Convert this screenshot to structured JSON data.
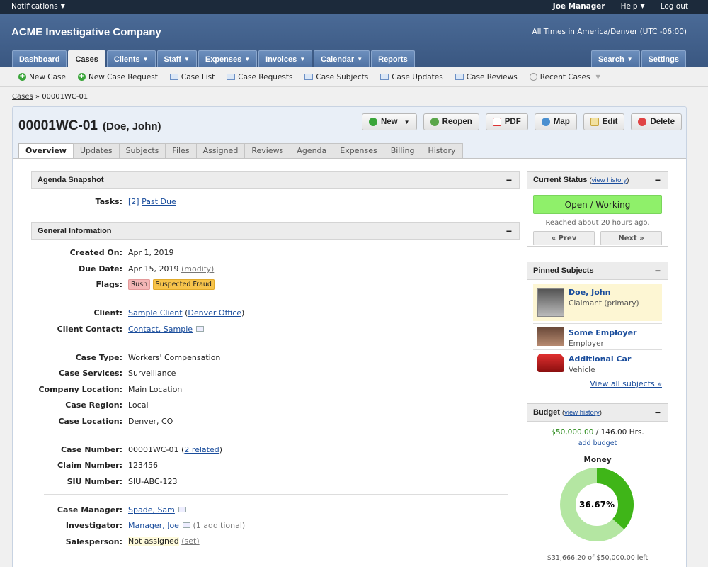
{
  "topbar": {
    "notifications": "Notifications",
    "user": "Joe Manager",
    "help": "Help",
    "logout": "Log out"
  },
  "header": {
    "company": "ACME Investigative Company",
    "timezone": "All Times in America/Denver (UTC -06:00)"
  },
  "nav": {
    "tabs": [
      {
        "label": "Dashboard"
      },
      {
        "label": "Cases"
      },
      {
        "label": "Clients"
      },
      {
        "label": "Staff"
      },
      {
        "label": "Expenses"
      },
      {
        "label": "Invoices"
      },
      {
        "label": "Calendar"
      },
      {
        "label": "Reports"
      }
    ],
    "search": "Search",
    "settings": "Settings"
  },
  "toolbar": {
    "new_case": "New Case",
    "new_case_request": "New Case Request",
    "case_list": "Case List",
    "case_requests": "Case Requests",
    "case_subjects": "Case Subjects",
    "case_updates": "Case Updates",
    "case_reviews": "Case Reviews",
    "recent_cases": "Recent Cases"
  },
  "breadcrumb": {
    "root": "Cases",
    "sep": "»",
    "current": "00001WC-01"
  },
  "case": {
    "number": "00001WC-01",
    "name": "(Doe, John)"
  },
  "actions": {
    "new": "New",
    "reopen": "Reopen",
    "pdf": "PDF",
    "map": "Map",
    "edit": "Edit",
    "delete": "Delete"
  },
  "subtabs": [
    "Overview",
    "Updates",
    "Subjects",
    "Files",
    "Assigned",
    "Reviews",
    "Agenda",
    "Expenses",
    "Billing",
    "History"
  ],
  "agenda": {
    "title": "Agenda Snapshot",
    "tasks_label": "Tasks:",
    "tasks_count": "[2]",
    "tasks_link": "Past Due"
  },
  "general": {
    "title": "General Information",
    "created_label": "Created On:",
    "created": "Apr 1, 2019",
    "due_label": "Due Date:",
    "due": "Apr 15, 2019",
    "due_modify": "(modify)",
    "flags_label": "Flags:",
    "flag_rush": "Rush",
    "flag_fraud": "Suspected Fraud",
    "client_label": "Client:",
    "client": "Sample Client",
    "client_office": "Denver Office",
    "contact_label": "Client Contact:",
    "contact": "Contact, Sample",
    "type_label": "Case Type:",
    "type": "Workers' Compensation",
    "services_label": "Case Services:",
    "services": "Surveillance",
    "company_loc_label": "Company Location:",
    "company_loc": "Main Location",
    "region_label": "Case Region:",
    "region": "Local",
    "case_loc_label": "Case Location:",
    "case_loc": "Denver, CO",
    "case_number_label": "Case Number:",
    "case_number": "00001WC-01",
    "related": "2 related",
    "claim_label": "Claim Number:",
    "claim": "123456",
    "siu_label": "SIU Number:",
    "siu": "SIU-ABC-123",
    "manager_label": "Case Manager:",
    "manager": "Spade, Sam",
    "investigator_label": "Investigator:",
    "investigator": "Manager, Joe",
    "additional": "(1 additional)",
    "sales_label": "Salesperson:",
    "sales": "Not assigned",
    "sales_set": "(set)"
  },
  "status": {
    "title": "Current Status",
    "history": "view history",
    "value": "Open / Working",
    "reached": "Reached about 20 hours ago.",
    "prev": "« Prev",
    "next": "Next »"
  },
  "pinned": {
    "title": "Pinned Subjects",
    "items": [
      {
        "name": "Doe, John",
        "type": "Claimant (primary)"
      },
      {
        "name": "Some Employer",
        "type": "Employer"
      },
      {
        "name": "Additional Car",
        "type": "Vehicle"
      }
    ],
    "view_all": "View all subjects »"
  },
  "budget": {
    "title": "Budget",
    "history": "view history",
    "money": "$50,000.00",
    "slash": "/",
    "hours": "146.00 Hrs.",
    "add": "add budget",
    "chart_title": "Money",
    "percent": "36.67%",
    "percent_value": 36.67,
    "left": "$31,666.20 of $50,000.00 left",
    "colors": {
      "used": "#3fb518",
      "remaining": "#b4e6a2"
    }
  }
}
